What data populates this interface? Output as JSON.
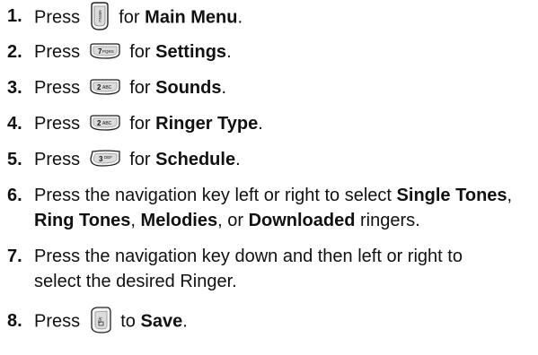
{
  "steps": [
    {
      "number": "1.",
      "before": "Press",
      "key": "menu-key",
      "middle": "for",
      "bold": "Main Menu",
      "after": "."
    },
    {
      "number": "2.",
      "before": "Press",
      "key": "7pqrs-key",
      "middle": "for",
      "bold": "Settings",
      "after": "."
    },
    {
      "number": "3.",
      "before": "Press",
      "key": "2abc-key",
      "middle": "for",
      "bold": "Sounds",
      "after": "."
    },
    {
      "number": "4.",
      "before": "Press",
      "key": "2abc-key",
      "middle": "for",
      "bold": "Ringer Type",
      "after": "."
    },
    {
      "number": "5.",
      "before": "Press",
      "key": "3def-key",
      "middle": "for",
      "bold": "Schedule",
      "after": "."
    },
    {
      "number": "6.",
      "line1_pre": "Press the navigation key left or right to select ",
      "line1_bold": "Single Tones",
      "line1_post": ",",
      "line2_bold_a": "Ring Tones",
      "line2_sep_a": ", ",
      "line2_bold_b": "Melodies",
      "line2_sep_b": ", or ",
      "line2_bold_c": "Downloaded",
      "line2_post": " ringers."
    },
    {
      "number": "7.",
      "line1": "Press the navigation key down and then left or right to",
      "line2": "select the desired Ringer."
    },
    {
      "number": "8.",
      "before": "Press",
      "key": "ok-key",
      "middle": "to",
      "bold": "Save",
      "after": "."
    }
  ],
  "keys": {
    "menu_key_label": "MENU",
    "pqrs_key_label": "7PQRS",
    "abc_key_label": "2ABC",
    "def_key_label": "3DEF",
    "ok_key_label": "OK"
  }
}
